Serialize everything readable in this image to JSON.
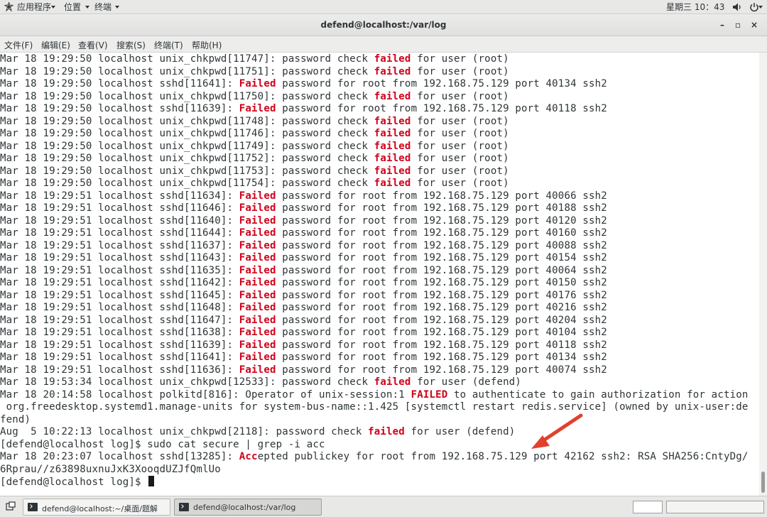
{
  "topbar": {
    "applications": "应用程序",
    "places": "位置",
    "app_name": "终端",
    "clock": "星期三 10：43",
    "icons": [
      "applications-icon",
      "volume-icon",
      "power-icon"
    ]
  },
  "window": {
    "title": "defend@localhost:/var/log",
    "minimize": "–",
    "maximize": "▫",
    "close": "×"
  },
  "menu": [
    "文件(F)",
    "编辑(E)",
    "查看(V)",
    "搜索(S)",
    "终端(T)",
    "帮助(H)"
  ],
  "accent_colors": {
    "failed_highlight": "#d0021b",
    "annotation_arrow": "#e0412f"
  },
  "terminal": {
    "lines": [
      [
        {
          "t": "Mar 18 19:29:50 localhost unix_chkpwd[11747]: password check "
        },
        {
          "t": "failed",
          "hl": true
        },
        {
          "t": " for user (root)"
        }
      ],
      [
        {
          "t": "Mar 18 19:29:50 localhost unix_chkpwd[11751]: password check "
        },
        {
          "t": "failed",
          "hl": true
        },
        {
          "t": " for user (root)"
        }
      ],
      [
        {
          "t": "Mar 18 19:29:50 localhost sshd[11641]: "
        },
        {
          "t": "Failed",
          "hl": true
        },
        {
          "t": " password for root from 192.168.75.129 port 40134 ssh2"
        }
      ],
      [
        {
          "t": "Mar 18 19:29:50 localhost unix_chkpwd[11750]: password check "
        },
        {
          "t": "failed",
          "hl": true
        },
        {
          "t": " for user (root)"
        }
      ],
      [
        {
          "t": "Mar 18 19:29:50 localhost sshd[11639]: "
        },
        {
          "t": "Failed",
          "hl": true
        },
        {
          "t": " password for root from 192.168.75.129 port 40118 ssh2"
        }
      ],
      [
        {
          "t": "Mar 18 19:29:50 localhost unix_chkpwd[11748]: password check "
        },
        {
          "t": "failed",
          "hl": true
        },
        {
          "t": " for user (root)"
        }
      ],
      [
        {
          "t": "Mar 18 19:29:50 localhost unix_chkpwd[11746]: password check "
        },
        {
          "t": "failed",
          "hl": true
        },
        {
          "t": " for user (root)"
        }
      ],
      [
        {
          "t": "Mar 18 19:29:50 localhost unix_chkpwd[11749]: password check "
        },
        {
          "t": "failed",
          "hl": true
        },
        {
          "t": " for user (root)"
        }
      ],
      [
        {
          "t": "Mar 18 19:29:50 localhost unix_chkpwd[11752]: password check "
        },
        {
          "t": "failed",
          "hl": true
        },
        {
          "t": " for user (root)"
        }
      ],
      [
        {
          "t": "Mar 18 19:29:50 localhost unix_chkpwd[11753]: password check "
        },
        {
          "t": "failed",
          "hl": true
        },
        {
          "t": " for user (root)"
        }
      ],
      [
        {
          "t": "Mar 18 19:29:50 localhost unix_chkpwd[11754]: password check "
        },
        {
          "t": "failed",
          "hl": true
        },
        {
          "t": " for user (root)"
        }
      ],
      [
        {
          "t": "Mar 18 19:29:51 localhost sshd[11634]: "
        },
        {
          "t": "Failed",
          "hl": true
        },
        {
          "t": " password for root from 192.168.75.129 port 40066 ssh2"
        }
      ],
      [
        {
          "t": "Mar 18 19:29:51 localhost sshd[11646]: "
        },
        {
          "t": "Failed",
          "hl": true
        },
        {
          "t": " password for root from 192.168.75.129 port 40188 ssh2"
        }
      ],
      [
        {
          "t": "Mar 18 19:29:51 localhost sshd[11640]: "
        },
        {
          "t": "Failed",
          "hl": true
        },
        {
          "t": " password for root from 192.168.75.129 port 40120 ssh2"
        }
      ],
      [
        {
          "t": "Mar 18 19:29:51 localhost sshd[11644]: "
        },
        {
          "t": "Failed",
          "hl": true
        },
        {
          "t": " password for root from 192.168.75.129 port 40160 ssh2"
        }
      ],
      [
        {
          "t": "Mar 18 19:29:51 localhost sshd[11637]: "
        },
        {
          "t": "Failed",
          "hl": true
        },
        {
          "t": " password for root from 192.168.75.129 port 40088 ssh2"
        }
      ],
      [
        {
          "t": "Mar 18 19:29:51 localhost sshd[11643]: "
        },
        {
          "t": "Failed",
          "hl": true
        },
        {
          "t": " password for root from 192.168.75.129 port 40154 ssh2"
        }
      ],
      [
        {
          "t": "Mar 18 19:29:51 localhost sshd[11635]: "
        },
        {
          "t": "Failed",
          "hl": true
        },
        {
          "t": " password for root from 192.168.75.129 port 40064 ssh2"
        }
      ],
      [
        {
          "t": "Mar 18 19:29:51 localhost sshd[11642]: "
        },
        {
          "t": "Failed",
          "hl": true
        },
        {
          "t": " password for root from 192.168.75.129 port 40150 ssh2"
        }
      ],
      [
        {
          "t": "Mar 18 19:29:51 localhost sshd[11645]: "
        },
        {
          "t": "Failed",
          "hl": true
        },
        {
          "t": " password for root from 192.168.75.129 port 40176 ssh2"
        }
      ],
      [
        {
          "t": "Mar 18 19:29:51 localhost sshd[11648]: "
        },
        {
          "t": "Failed",
          "hl": true
        },
        {
          "t": " password for root from 192.168.75.129 port 40216 ssh2"
        }
      ],
      [
        {
          "t": "Mar 18 19:29:51 localhost sshd[11647]: "
        },
        {
          "t": "Failed",
          "hl": true
        },
        {
          "t": " password for root from 192.168.75.129 port 40204 ssh2"
        }
      ],
      [
        {
          "t": "Mar 18 19:29:51 localhost sshd[11638]: "
        },
        {
          "t": "Failed",
          "hl": true
        },
        {
          "t": " password for root from 192.168.75.129 port 40104 ssh2"
        }
      ],
      [
        {
          "t": "Mar 18 19:29:51 localhost sshd[11639]: "
        },
        {
          "t": "Failed",
          "hl": true
        },
        {
          "t": " password for root from 192.168.75.129 port 40118 ssh2"
        }
      ],
      [
        {
          "t": "Mar 18 19:29:51 localhost sshd[11641]: "
        },
        {
          "t": "Failed",
          "hl": true
        },
        {
          "t": " password for root from 192.168.75.129 port 40134 ssh2"
        }
      ],
      [
        {
          "t": "Mar 18 19:29:51 localhost sshd[11636]: "
        },
        {
          "t": "Failed",
          "hl": true
        },
        {
          "t": " password for root from 192.168.75.129 port 40074 ssh2"
        }
      ],
      [
        {
          "t": "Mar 18 19:53:34 localhost unix_chkpwd[12533]: password check "
        },
        {
          "t": "failed",
          "hl": true
        },
        {
          "t": " for user (defend)"
        }
      ],
      [
        {
          "t": "Mar 18 20:14:58 localhost polkitd[816]: Operator of unix-session:1 "
        },
        {
          "t": "FAILED",
          "hl": true
        },
        {
          "t": " to authenticate to gain authorization for action"
        }
      ],
      [
        {
          "t": " org.freedesktop.systemd1.manage-units for system-bus-name::1.425 [systemctl restart redis.service] (owned by unix-user:de"
        }
      ],
      [
        {
          "t": "fend)"
        }
      ],
      [
        {
          "t": "Aug  5 10:22:13 localhost unix_chkpwd[2118]: password check "
        },
        {
          "t": "failed",
          "hl": true
        },
        {
          "t": " for user (defend)"
        }
      ],
      [
        {
          "t": "[defend@localhost log]$ sudo cat secure | grep -i acc"
        }
      ],
      [
        {
          "t": "Mar 18 20:23:07 localhost sshd[13285]: "
        },
        {
          "t": "Acc",
          "hl": true
        },
        {
          "t": "epted publickey for root from 192.168.75.129 port 42162 ssh2: RSA SHA256:CntyDg/"
        }
      ],
      [
        {
          "t": "6Rprau//z63898uxnuJxK3XooqdUZJfQmlUo"
        }
      ],
      [
        {
          "t": "[defend@localhost log]$ "
        }
      ]
    ]
  },
  "taskbar": {
    "tasks": [
      {
        "label": "defend@localhost:~/桌面/题解",
        "active": false
      },
      {
        "label": "defend@localhost:/var/log",
        "active": true
      }
    ]
  }
}
